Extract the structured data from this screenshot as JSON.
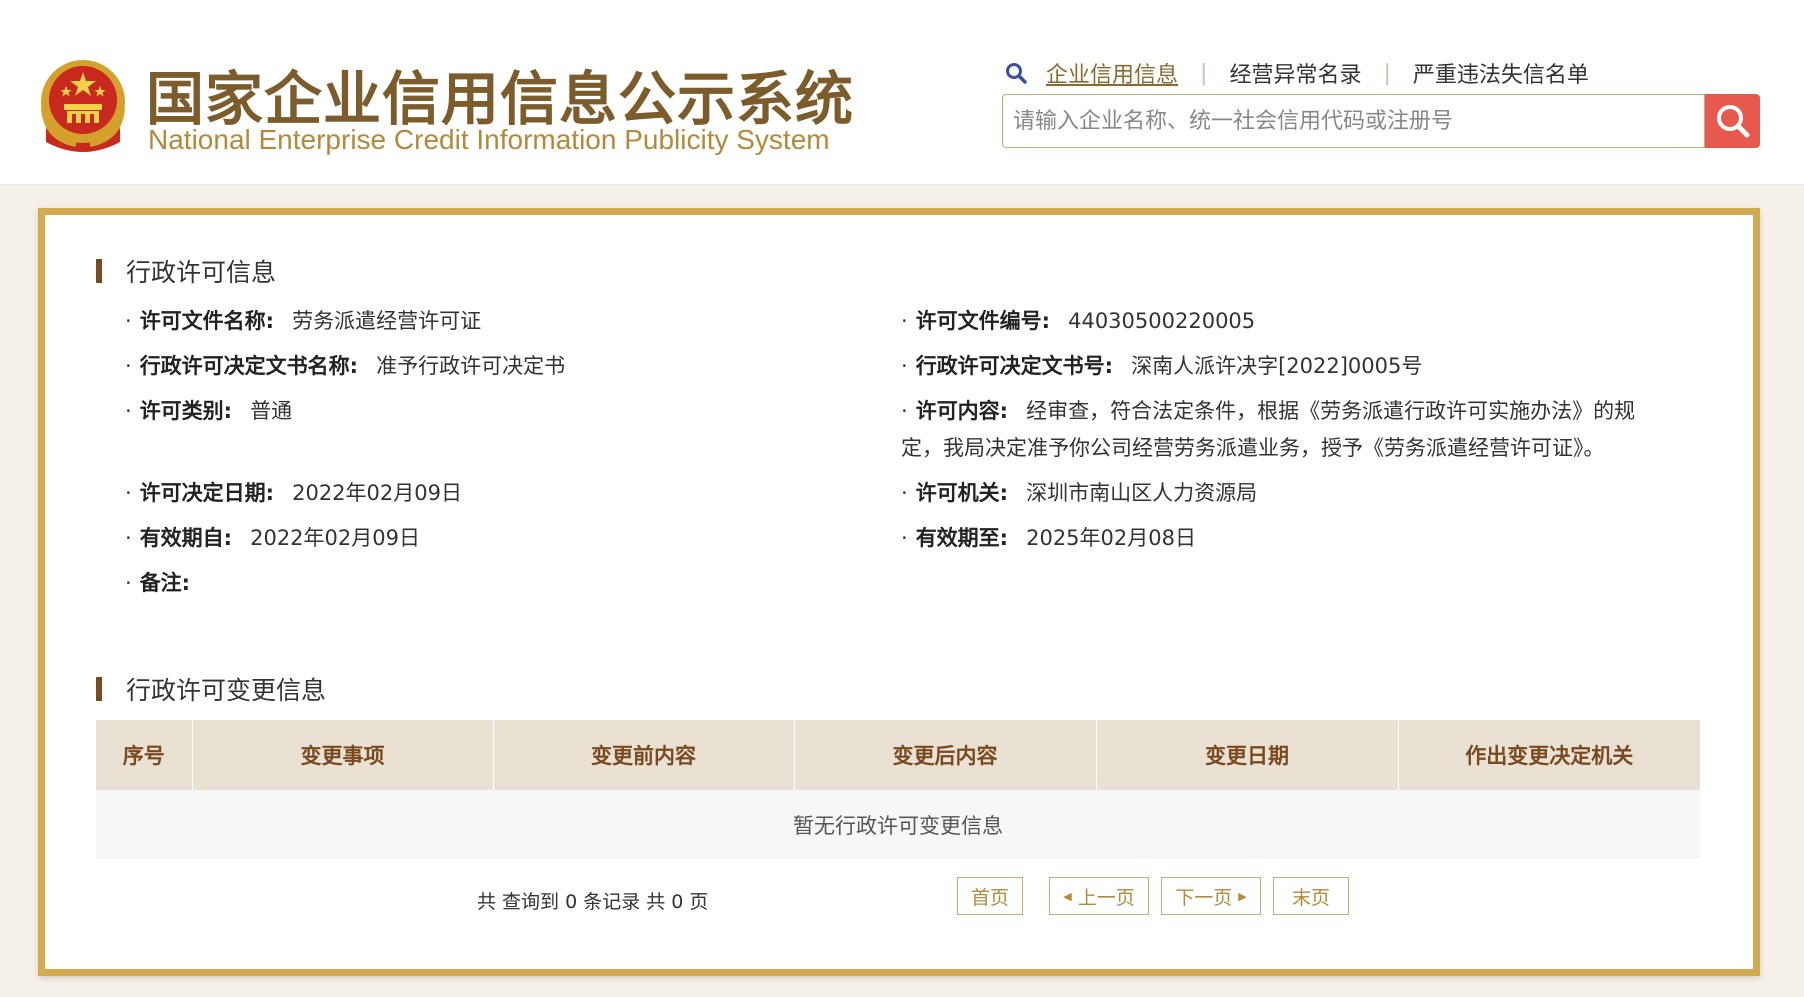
{
  "header": {
    "logo_cn": "国家企业信用信息公示系统",
    "logo_en": "National Enterprise Credit Information Publicity System",
    "nav": [
      {
        "label": "企业信用信息",
        "active": true
      },
      {
        "label": "经营异常名录",
        "active": false
      },
      {
        "label": "严重违法失信名单",
        "active": false
      }
    ],
    "search_placeholder": "请输入企业名称、统一社会信用代码或注册号",
    "accent_color": "#e8594d",
    "brand_color": "#7b5c2a"
  },
  "permit": {
    "section_title": "行政许可信息",
    "fields": {
      "doc_name": {
        "label": "许可文件名称:",
        "value": "劳务派遣经营许可证"
      },
      "doc_no": {
        "label": "许可文件编号:",
        "value": "44030500220005"
      },
      "decision_name": {
        "label": "行政许可决定文书名称:",
        "value": "准予行政许可决定书"
      },
      "decision_no": {
        "label": "行政许可决定文书号:",
        "value": "深南人派许决字[2022]0005号"
      },
      "category": {
        "label": "许可类别:",
        "value": "普通"
      },
      "content": {
        "label": "许可内容:",
        "value": "经审查，符合法定条件，根据《劳务派遣行政许可实施办法》的规定，我局决定准予你公司经营劳务派遣业务，授予《劳务派遣经营许可证》。"
      },
      "decision_date": {
        "label": "许可决定日期:",
        "value": "2022年02月09日"
      },
      "authority": {
        "label": "许可机关:",
        "value": "深圳市南山区人力资源局"
      },
      "valid_from": {
        "label": "有效期自:",
        "value": "2022年02月09日"
      },
      "valid_to": {
        "label": "有效期至:",
        "value": "2025年02月08日"
      },
      "remark": {
        "label": "备注:",
        "value": ""
      }
    }
  },
  "changes": {
    "section_title": "行政许可变更信息",
    "columns": [
      "序号",
      "变更事项",
      "变更前内容",
      "变更后内容",
      "变更日期",
      "作出变更决定机关"
    ],
    "empty_text": "暂无行政许可变更信息",
    "pager_info": "共 查询到 0 条记录 共 0 页",
    "pager": {
      "first": "首页",
      "prev": "上一页",
      "next": "下一页",
      "last": "末页"
    }
  }
}
